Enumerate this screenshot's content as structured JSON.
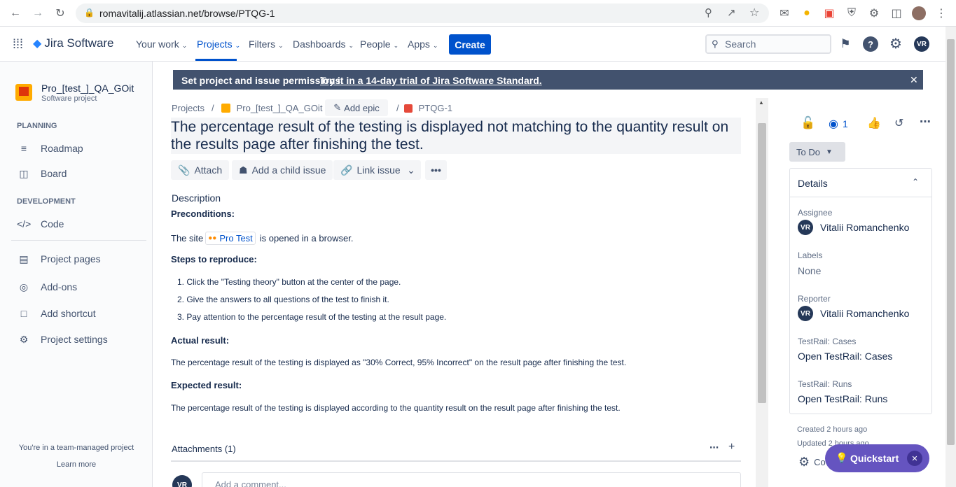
{
  "browser": {
    "url": "romavitalij.atlassian.net/browse/PTQG-1"
  },
  "topnav": {
    "product": "Jira Software",
    "items": [
      "Your work",
      "Projects",
      "Filters",
      "Dashboards",
      "People",
      "Apps"
    ],
    "create": "Create",
    "search_placeholder": "Search",
    "avatar": "VR"
  },
  "sidebar": {
    "project_name": "Pro_[test_]_QA_GOit",
    "project_type": "Software project",
    "planning_header": "PLANNING",
    "roadmap": "Roadmap",
    "board": "Board",
    "development_header": "DEVELOPMENT",
    "code": "Code",
    "project_pages": "Project pages",
    "addons": "Add-ons",
    "add_shortcut": "Add shortcut",
    "project_settings": "Project settings",
    "team_managed": "You're in a team-managed project",
    "learn_more": "Learn more"
  },
  "banner": {
    "text": "Set project and issue permissions.",
    "link": "Try it in a 14-day trial of Jira Software Standard."
  },
  "breadcrumb": {
    "projects": "Projects",
    "project": "Pro_[test_]_QA_GOit",
    "add_epic": "Add epic",
    "issue_key": "PTQG-1"
  },
  "issue": {
    "title": "The percentage result of the testing is displayed not matching to the quantity result on the results page after finishing the test.",
    "attach": "Attach",
    "add_child": "Add a child issue",
    "link_issue": "Link issue",
    "description_label": "Description",
    "preconditions": "Preconditions:",
    "site_prefix": "The site",
    "site_link": "Pro Test",
    "site_suffix": "is opened in a browser.",
    "steps_label": "Steps to reproduce:",
    "steps": [
      "Click the \"Testing theory\" button at the center of the page.",
      "Give the answers to all questions of the test to finish it.",
      "Pay attention to the percentage result of the testing at the result page."
    ],
    "actual_label": "Actual result:",
    "actual_text": "The percentage result of the testing is displayed as \"30% Correct, 95% Incorrect\" on the result page after finishing the test.",
    "expected_label": "Expected result:",
    "expected_text": "The percentage result of the testing is displayed according to the quantity result on the result page after finishing the test.",
    "attachments": "Attachments (1)",
    "comment_placeholder": "Add a comment...",
    "comment_avatar": "VR"
  },
  "right": {
    "watch_count": "1",
    "status": "To Do",
    "details_header": "Details",
    "assignee_label": "Assignee",
    "assignee": "Vitalii Romanchenko",
    "labels_label": "Labels",
    "labels": "None",
    "reporter_label": "Reporter",
    "reporter": "Vitalii Romanchenko",
    "tr_cases_label": "TestRail: Cases",
    "tr_cases_open": "Open",
    "tr_cases_value": "TestRail: Cases",
    "tr_runs_label": "TestRail: Runs",
    "tr_runs_open": "Open",
    "tr_runs_value": "TestRail: Runs",
    "created": "Created 2 hours ago",
    "updated": "Updated 2 hours ago",
    "configure": "Co",
    "avatar": "VR",
    "quickstart": "Quickstart"
  }
}
